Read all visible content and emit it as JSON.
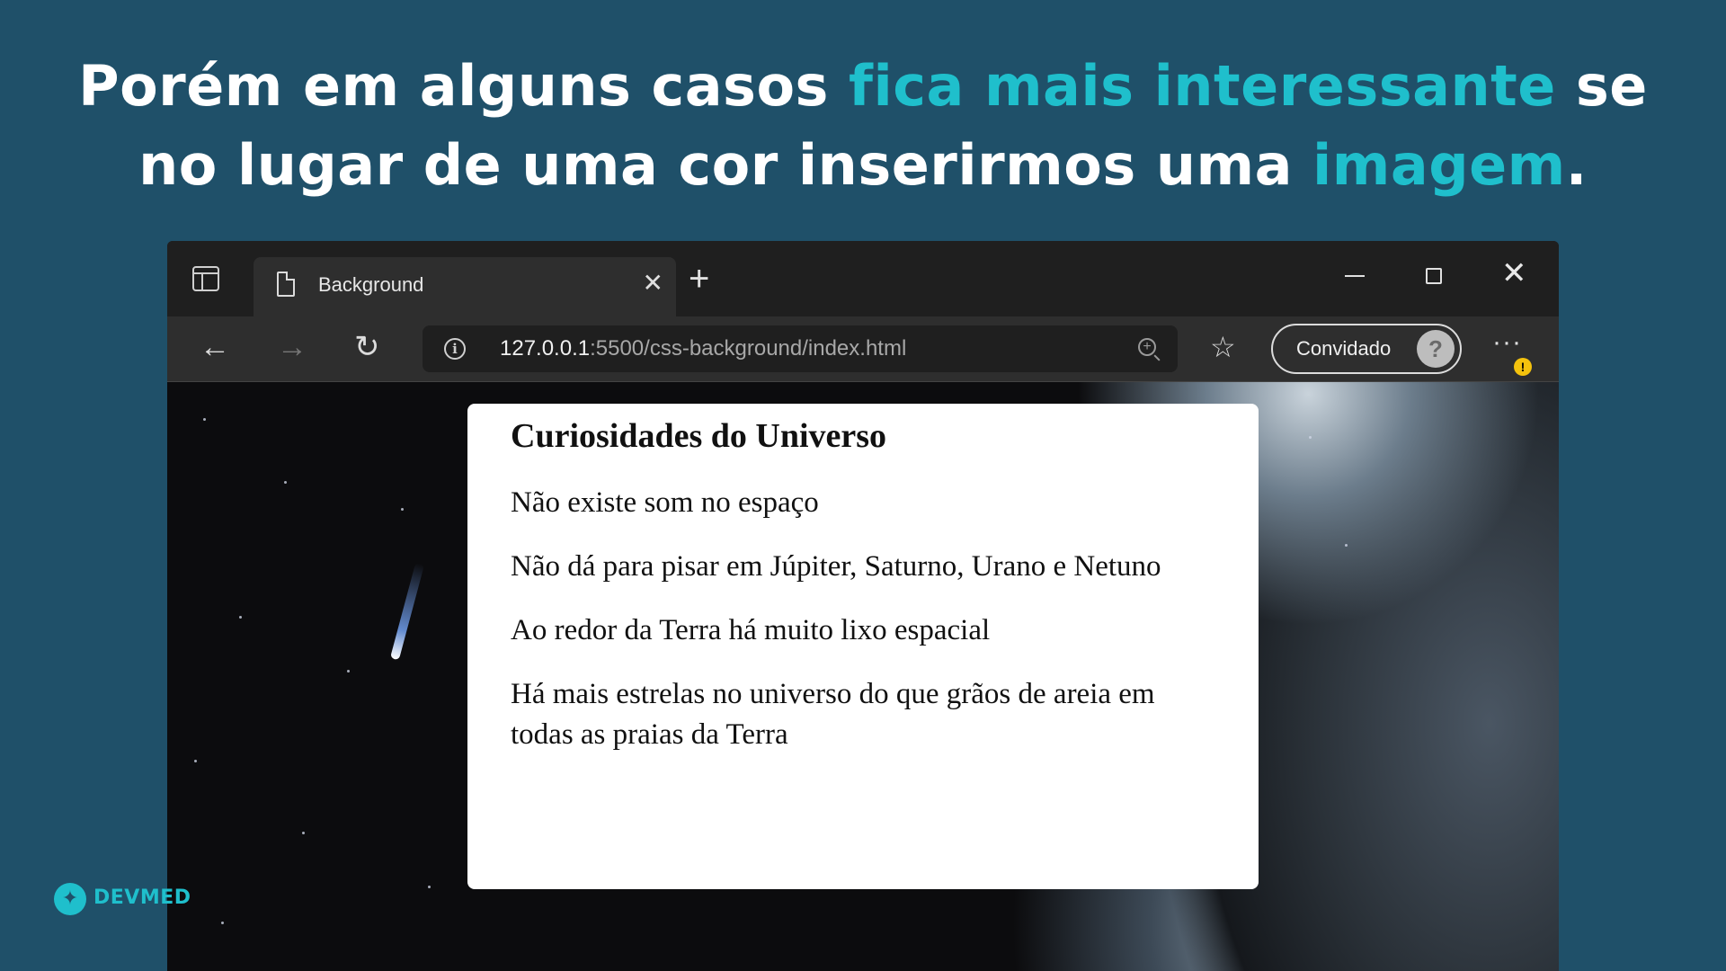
{
  "headline": {
    "line1": {
      "a": "Porém em alguns casos ",
      "b": "fica mais interessante",
      "c": " se"
    },
    "line2": {
      "a": "no lugar de uma cor inserirmos uma ",
      "b": "imagem",
      "c": "."
    },
    "highlight_color": "#1fbfcc"
  },
  "browser": {
    "tab_title": "Background",
    "url_host": "127.0.0.1",
    "url_path": ":5500/css-background/index.html",
    "profile_label": "Convidado",
    "icons": {
      "tab_actions": "tab-actions-icon",
      "page": "page-icon",
      "close": "close-icon",
      "new_tab": "plus-icon",
      "back": "arrow-left-icon",
      "forward": "arrow-right-icon",
      "reload": "reload-icon",
      "info": "info-icon",
      "zoom": "zoom-in-icon",
      "favorites": "favorites-icon",
      "more": "more-icon"
    }
  },
  "card": {
    "title": "Curiosidades do Universo",
    "items": [
      "Não existe som no espaço",
      "Não dá para pisar em Júpiter, Saturno, Urano e Netuno",
      "Ao redor da Terra há muito lixo espacial",
      "Há mais estrelas no universo do que grãos de areia em todas as praias da Terra"
    ]
  },
  "logo": {
    "text": "DEVMED"
  },
  "colors": {
    "background": "#1f5069",
    "accent": "#1fbfcc"
  }
}
